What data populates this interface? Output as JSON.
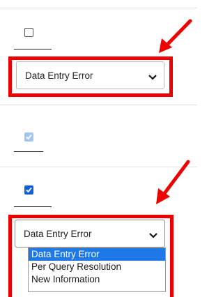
{
  "form": {
    "row1": {
      "checkbox_checked": false
    },
    "row1_select": {
      "value": "Data Entry Error"
    },
    "row2": {
      "checkbox_checked": true,
      "checkbox_disabled": true
    },
    "row3": {
      "checkbox_checked": true
    },
    "row3_select": {
      "value": "Data Entry Error",
      "open": true,
      "options": [
        "Data Entry Error",
        "Per Query Resolution",
        "New Information"
      ],
      "highlighted_index": 0
    }
  },
  "annotation": {
    "highlight_color": "#ee0000"
  },
  "colors": {
    "checkbox_checked": "#0f61dd",
    "checkbox_disabled_checked": "#a4c4f2",
    "option_highlight": "#1e78e6"
  }
}
